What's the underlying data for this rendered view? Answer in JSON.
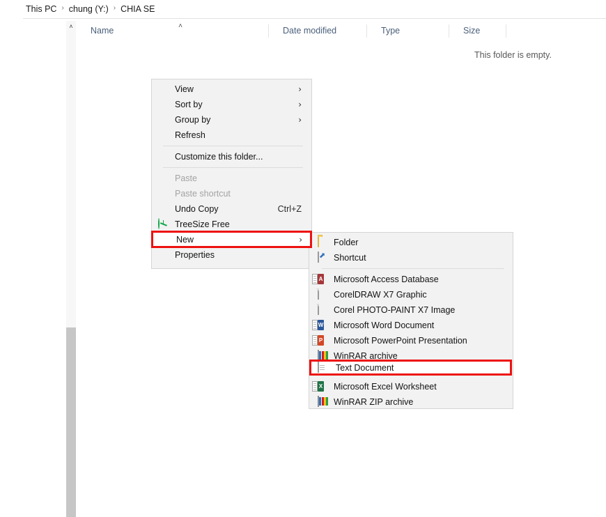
{
  "breadcrumb": {
    "separator": "›",
    "items": [
      "This PC",
      "chung (Y:)",
      "CHIA SE"
    ]
  },
  "file_list": {
    "columns": [
      {
        "label": "Name"
      },
      {
        "label": "Date modified"
      },
      {
        "label": "Type"
      },
      {
        "label": "Size"
      }
    ],
    "sort_caret": "˄",
    "empty_message": "This folder is empty."
  },
  "scrollbar": {
    "up_arrow": "˄"
  },
  "context_menu": {
    "items": [
      {
        "label": "View",
        "submenu_arrow": "›",
        "icon": "",
        "disabled": false
      },
      {
        "label": "Sort by",
        "submenu_arrow": "›",
        "icon": "",
        "disabled": false
      },
      {
        "label": "Group by",
        "submenu_arrow": "›",
        "icon": "",
        "disabled": false
      },
      {
        "label": "Refresh",
        "submenu_arrow": "",
        "icon": "",
        "disabled": false
      },
      {
        "label": "Customize this folder...",
        "submenu_arrow": "",
        "icon": "",
        "disabled": false
      },
      {
        "label": "Paste",
        "submenu_arrow": "",
        "icon": "",
        "disabled": true
      },
      {
        "label": "Paste shortcut",
        "submenu_arrow": "",
        "icon": "",
        "disabled": true
      },
      {
        "label": "Undo Copy",
        "accelerator": "Ctrl+Z",
        "submenu_arrow": "",
        "icon": "",
        "disabled": false
      },
      {
        "label": "TreeSize Free",
        "submenu_arrow": "",
        "icon": "treesize-icon",
        "disabled": false
      },
      {
        "label": "New",
        "submenu_arrow": "›",
        "icon": "",
        "disabled": false
      },
      {
        "label": "Properties",
        "submenu_arrow": "",
        "icon": "",
        "disabled": false
      }
    ]
  },
  "new_submenu": {
    "items": [
      {
        "label": "Folder",
        "icon": "folder-icon"
      },
      {
        "label": "Shortcut",
        "icon": "shortcut-icon"
      },
      {
        "label": "Microsoft Access Database",
        "icon": "access-icon"
      },
      {
        "label": "CorelDRAW X7 Graphic",
        "icon": "blank-page-icon"
      },
      {
        "label": "Corel PHOTO-PAINT X7 Image",
        "icon": "blank-page-icon"
      },
      {
        "label": "Microsoft Word Document",
        "icon": "word-icon"
      },
      {
        "label": "Microsoft PowerPoint Presentation",
        "icon": "powerpoint-icon"
      },
      {
        "label": "WinRAR archive",
        "icon": "winrar-icon"
      },
      {
        "label": "Text Document",
        "icon": "text-document-icon"
      },
      {
        "label": "Microsoft Excel Worksheet",
        "icon": "excel-icon"
      },
      {
        "label": "WinRAR ZIP archive",
        "icon": "winrar-icon"
      }
    ]
  },
  "highlights": {
    "color": "#ee1111",
    "new_label": "New",
    "new_arrow": "›",
    "text_document_label": "Text Document"
  }
}
